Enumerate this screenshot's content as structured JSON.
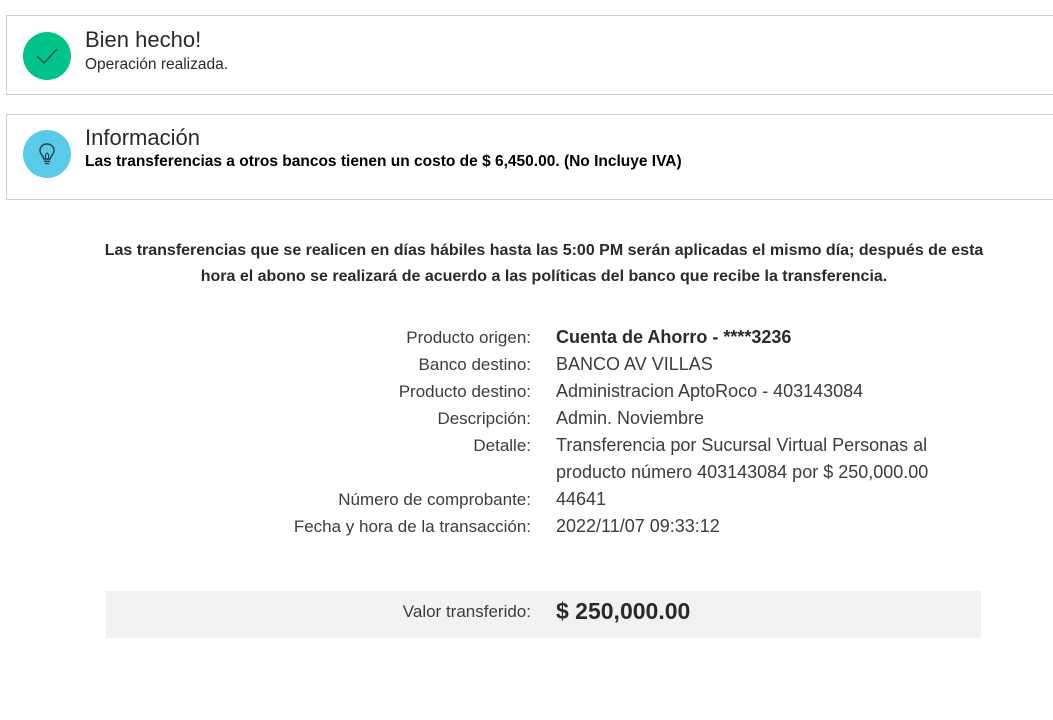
{
  "success_alert": {
    "title": "Bien hecho!",
    "message": "Operación realizada.",
    "icon": "check-icon",
    "color": "#00c389"
  },
  "info_alert": {
    "title": "Información",
    "message": "Las transferencias a otros bancos tienen un costo de $ 6,450.00. (No Incluye IVA)",
    "icon": "lightbulb-icon",
    "color": "#59cbe8"
  },
  "notice": "Las transferencias que se realicen en días hábiles hasta las 5:00 PM serán aplicadas el mismo día; después de esta hora el abono se realizará de acuerdo a las políticas del banco que recibe la transferencia.",
  "details": {
    "producto_origen": {
      "label": "Producto origen:",
      "value": "Cuenta de Ahorro - ****3236"
    },
    "banco_destino": {
      "label": "Banco destino:",
      "value": "BANCO AV VILLAS"
    },
    "producto_destino": {
      "label": "Producto destino:",
      "value": "Administracion AptoRoco - 403143084"
    },
    "descripcion": {
      "label": "Descripción:",
      "value": "Admin. Noviembre"
    },
    "detalle": {
      "label": "Detalle:",
      "value": "Transferencia por Sucursal Virtual Personas al producto número 403143084 por $ 250,000.00"
    },
    "comprobante": {
      "label": "Número de comprobante:",
      "value": "44641"
    },
    "fecha": {
      "label": "Fecha y hora de la transacción:",
      "value": "2022/11/07 09:33:12"
    }
  },
  "total": {
    "label": "Valor transferido:",
    "value": "$ 250,000.00"
  }
}
